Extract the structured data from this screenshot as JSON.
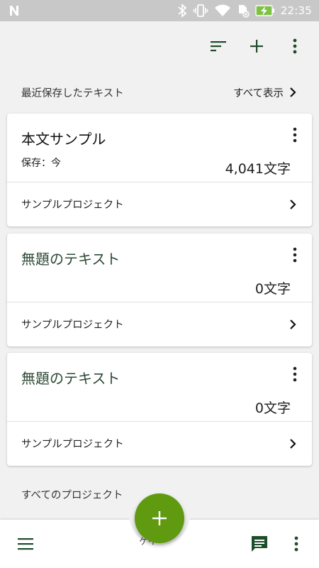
{
  "status_bar": {
    "time": "22:35",
    "icons": [
      "n-notification-icon",
      "bluetooth-icon",
      "vibrate-icon",
      "wifi-icon",
      "no-sim-icon",
      "battery-charging-icon"
    ]
  },
  "app_bar": {
    "icons": [
      "sort-icon",
      "add-icon",
      "more-vert-icon"
    ]
  },
  "recent_section": {
    "title": "最近保存したテキスト",
    "show_all_label": "すべて表示"
  },
  "cards": [
    {
      "title": "本文サンプル",
      "saved": "保存：今",
      "count": "4,041文字",
      "project": "サンプルプロジェクト"
    },
    {
      "title": "無題のテキスト",
      "count": "0文字",
      "project": "サンプルプロジェクト"
    },
    {
      "title": "無題のテキスト",
      "count": "0文字",
      "project": "サンプルプロジェクト"
    }
  ],
  "all_projects": {
    "title": "すべてのプロジェクト"
  },
  "bottom_bar": {
    "partial_text": "ケイ",
    "icons": [
      "menu-icon",
      "feedback-icon",
      "more-vert-icon"
    ]
  },
  "colors": {
    "accent_green": "#5f9a11",
    "icon_green": "#1e4d2b",
    "status_bar": "#c8c8c8",
    "battery": "#7dc242"
  }
}
